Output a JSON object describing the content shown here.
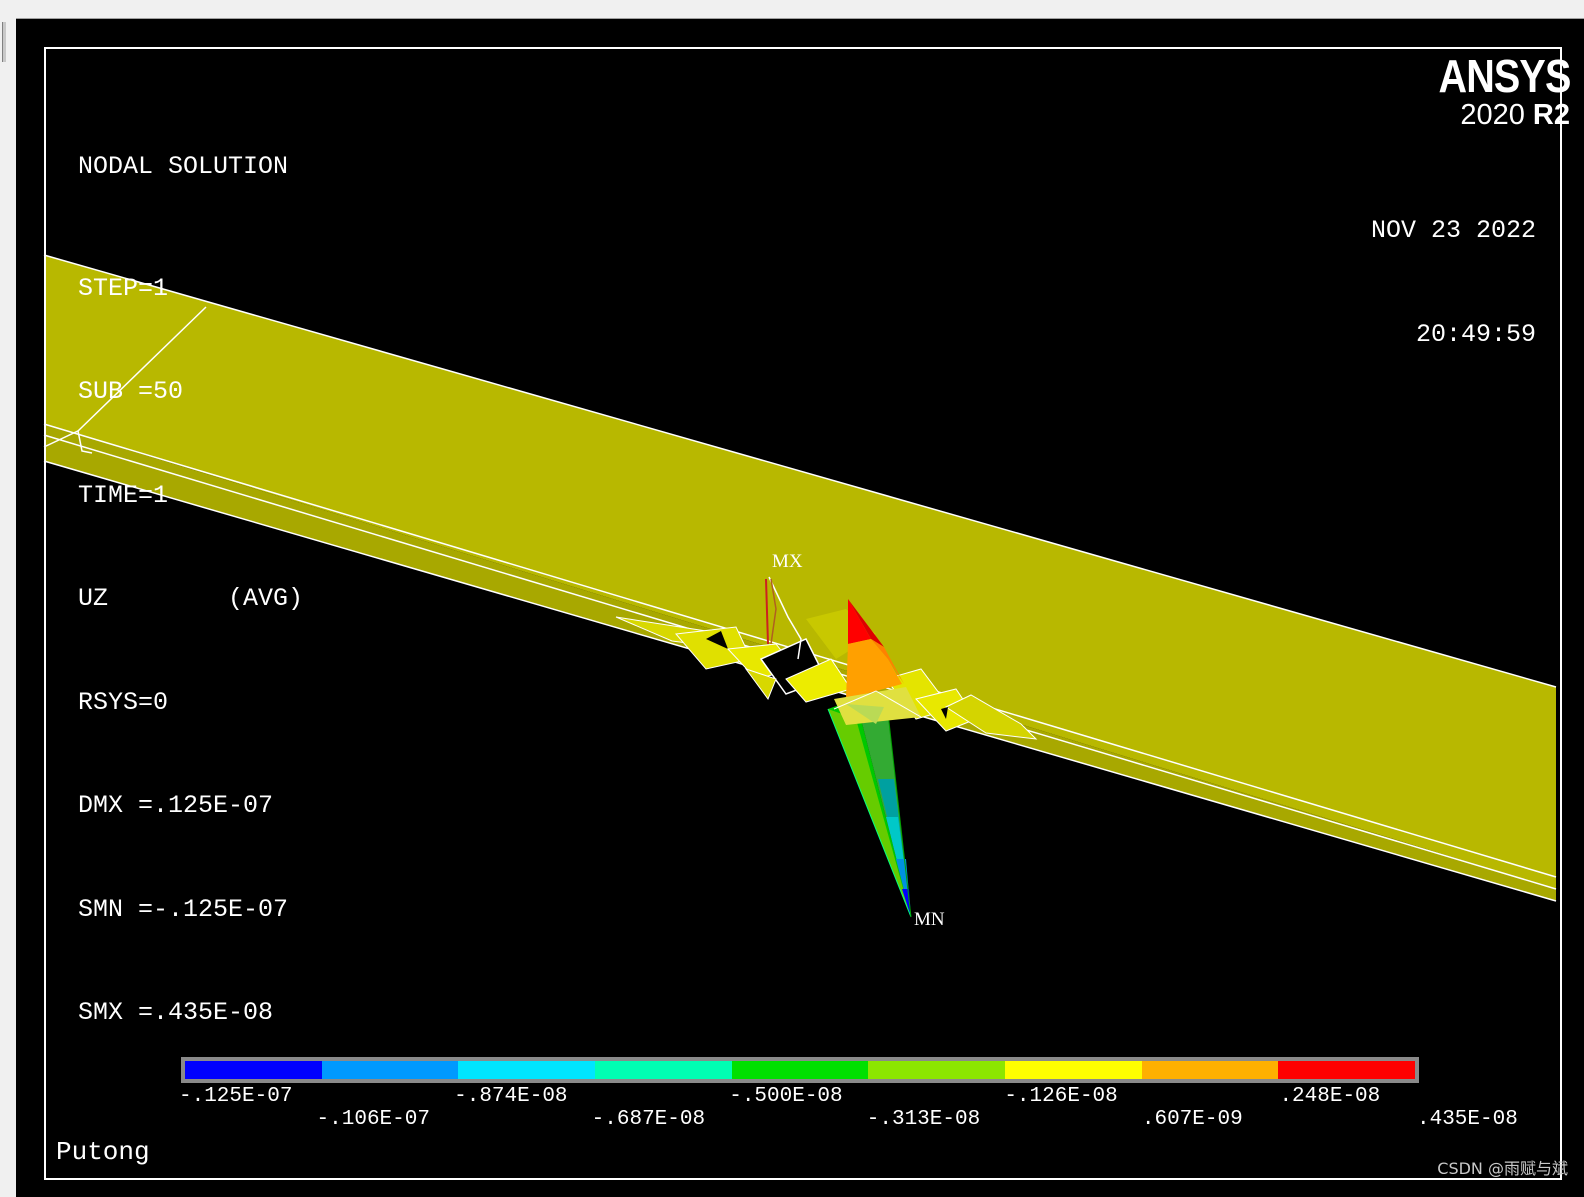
{
  "header": {
    "title": "NODAL SOLUTION",
    "lines": [
      "STEP=1",
      "SUB =50",
      "TIME=1",
      "UZ        (AVG)",
      "RSYS=0",
      "DMX =.125E-07",
      "SMN =-.125E-07",
      "SMX =.435E-08"
    ]
  },
  "logo": {
    "brand": "ANSYS",
    "version": "2020",
    "release": "R2"
  },
  "datetime": {
    "date": "NOV 23 2022",
    "time": "20:49:59"
  },
  "markers": {
    "max": "MX",
    "min": "MN"
  },
  "legend": {
    "colors": [
      "#0000ff",
      "#0099ff",
      "#00e5ff",
      "#00ffb3",
      "#00e000",
      "#8ce600",
      "#ffff00",
      "#ffb000",
      "#ff0000"
    ],
    "labels": [
      "-.125E-07",
      "-.106E-07",
      "-.874E-08",
      "-.687E-08",
      "-.500E-08",
      "-.313E-08",
      "-.126E-08",
      ".607E-09",
      ".248E-08",
      ".435E-08"
    ]
  },
  "footer": {
    "label": "Putong"
  },
  "watermark": "CSDN @雨赋与斌"
}
